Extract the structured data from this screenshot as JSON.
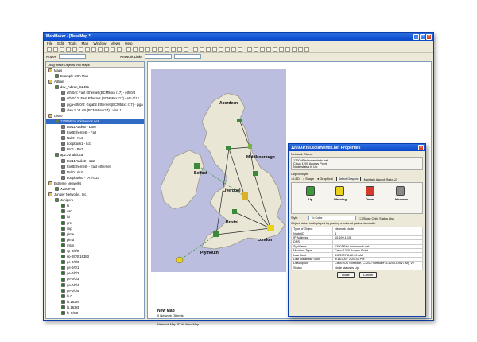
{
  "window": {
    "title": "MapMaker - [New Map *]"
  },
  "menu": [
    "File",
    "Edit",
    "Tools",
    "Map",
    "Window",
    "Views",
    "Help"
  ],
  "toolbar2": {
    "nodes_label": "Nodes",
    "tab_label": "Network Links"
  },
  "left_panel": {
    "header": "Drag these Objects into Maps",
    "items": [
      {
        "text": "Maps",
        "indent": 0,
        "icon": "folder-icon",
        "color": "#e8c04a"
      },
      {
        "text": "Example USA Map",
        "indent": 1,
        "icon": "map-icon",
        "color": "#4a8f3a"
      },
      {
        "text": "Adtran",
        "indent": 0,
        "icon": "folder-icon",
        "color": "#e8c04a"
      },
      {
        "text": "dev_Adtran_C2451",
        "indent": 1,
        "icon": "device-icon",
        "color": "#4a8f3a"
      },
      {
        "text": "eth 0/4: Fast Ethernet (BCM56xx r17) - eth 0/4",
        "indent": 2,
        "icon": "port-icon",
        "color": "#777"
      },
      {
        "text": "eth 0/12: Fast Ethernet (BCM56xx r17) - eth 0/12",
        "indent": 2,
        "icon": "port-icon",
        "color": "#777"
      },
      {
        "text": "giga-eth 0/4: Gigabit Ethernet (BCM56xx r17) - giga",
        "indent": 2,
        "icon": "port-icon",
        "color": "#777"
      },
      {
        "text": "vlan 1: VLAN (BCM56xx r17) - vlan 1",
        "indent": 2,
        "icon": "port-icon",
        "color": "#777"
      },
      {
        "text": "Cisco",
        "indent": 0,
        "icon": "folder-icon",
        "color": "#e8c04a"
      },
      {
        "text": "1200AP.tul.solarwinds.net",
        "indent": 1,
        "icon": "device-icon",
        "color": "#4a8f3a",
        "selected": true
      },
      {
        "text": "Dot11Radio0 - Dot0",
        "indent": 2,
        "icon": "port-icon",
        "color": "#777"
      },
      {
        "text": "FastEthernet0 - Fa0",
        "indent": 2,
        "icon": "port-icon",
        "color": "#777"
      },
      {
        "text": "Null0 - Nu0",
        "indent": 2,
        "icon": "port-icon",
        "color": "#777"
      },
      {
        "text": "Loopback1 - Lo1",
        "indent": 2,
        "icon": "port-icon",
        "color": "#777"
      },
      {
        "text": "BVI1 - BV1",
        "indent": 2,
        "icon": "port-icon",
        "color": "#777"
      },
      {
        "text": "ap2.zvnab.local",
        "indent": 1,
        "icon": "device-icon",
        "color": "#4a8f3a"
      },
      {
        "text": "Dot11Radio0 - 1111",
        "indent": 2,
        "icon": "port-icon",
        "color": "#777"
      },
      {
        "text": "FastEthernet0 - (fast ethernet)",
        "indent": 2,
        "icon": "port-icon",
        "color": "#777"
      },
      {
        "text": "Null0 - Nu0",
        "indent": 2,
        "icon": "port-icon",
        "color": "#777"
      },
      {
        "text": "Loopback0 - TATA123",
        "indent": 2,
        "icon": "port-icon",
        "color": "#777"
      },
      {
        "text": "Extreme Networks",
        "indent": 0,
        "icon": "folder-icon",
        "color": "#e8c04a"
      },
      {
        "text": "X250e-48",
        "indent": 1,
        "icon": "device-icon",
        "color": "#4a8f3a"
      },
      {
        "text": "Juniper Networks, Inc.",
        "indent": 0,
        "icon": "folder-icon",
        "color": "#e8c04a"
      },
      {
        "text": "Juniper1",
        "indent": 1,
        "icon": "device-icon",
        "color": "#4a8f3a"
      },
      {
        "text": "lo",
        "indent": 2,
        "icon": "port-icon",
        "color": "#2a7a2a"
      },
      {
        "text": "dsc",
        "indent": 2,
        "icon": "port-icon",
        "color": "#2a7a2a"
      },
      {
        "text": "lsi",
        "indent": 2,
        "icon": "port-icon",
        "color": "#2a7a2a"
      },
      {
        "text": "gre",
        "indent": 2,
        "icon": "port-icon",
        "color": "#2a7a2a"
      },
      {
        "text": "ipip",
        "indent": 2,
        "icon": "port-icon",
        "color": "#2a7a2a"
      },
      {
        "text": "pime",
        "indent": 2,
        "icon": "port-icon",
        "color": "#2a7a2a"
      },
      {
        "text": "pimd",
        "indent": 2,
        "icon": "port-icon",
        "color": "#2a7a2a"
      },
      {
        "text": "mtun",
        "indent": 2,
        "icon": "port-icon",
        "color": "#2a7a2a"
      },
      {
        "text": "sp-0/0/0",
        "indent": 2,
        "icon": "port-icon",
        "color": "#2a7a2a"
      },
      {
        "text": "sp-0/0/0.16383",
        "indent": 2,
        "icon": "port-icon",
        "color": "#2a7a2a"
      },
      {
        "text": "ge-0/0/0",
        "indent": 2,
        "icon": "port-icon",
        "color": "#2a7a2a"
      },
      {
        "text": "ge-0/0/1",
        "indent": 2,
        "icon": "port-icon",
        "color": "#2a7a2a"
      },
      {
        "text": "ge-0/0/2",
        "indent": 2,
        "icon": "port-icon",
        "color": "#2a7a2a"
      },
      {
        "text": "ge-0/0/3",
        "indent": 2,
        "icon": "port-icon",
        "color": "#2a7a2a"
      },
      {
        "text": "ge-0/0/4",
        "indent": 2,
        "icon": "port-icon",
        "color": "#2a7a2a"
      },
      {
        "text": "ge-0/0/5",
        "indent": 2,
        "icon": "port-icon",
        "color": "#2a7a2a"
      },
      {
        "text": "lo.0",
        "indent": 2,
        "icon": "port-icon",
        "color": "#2a7a2a"
      },
      {
        "text": "lo.16384",
        "indent": 2,
        "icon": "port-icon",
        "color": "#2a7a2a"
      },
      {
        "text": "lo.16385",
        "indent": 2,
        "icon": "port-icon",
        "color": "#2a7a2a"
      },
      {
        "text": "fe-0/0/0",
        "indent": 2,
        "icon": "port-icon",
        "color": "#2a7a2a"
      }
    ]
  },
  "map": {
    "tabs": [
      "Network Links",
      "",
      ""
    ],
    "labels": [
      "Aberdeen",
      "Middlesbrough",
      "Belfast",
      "Liverpool",
      "Bristol",
      "Plymouth",
      "London"
    ],
    "footer_title": "New Map",
    "footer_sub": "0 Network Objects",
    "footer_status": "Network Map ID ## New Map"
  },
  "dialog": {
    "title": "1200AP.tul.solarwinds.net Properties",
    "section_network": "Network Object",
    "obj_line1": "1200AP.tul.solarwinds.net",
    "obj_line2": "Cisco 1200 Access Point",
    "obj_line3": "Node status is Up.",
    "object_style_label": "Object Style",
    "radio_led": "LED",
    "radio_shape": "Shape",
    "radio_graphical": "Graphical",
    "select_graphic": "Select Graphic",
    "maintain_aspect": "Maintain Aspect Ratio",
    "statuses": [
      {
        "label": "Up",
        "color": "#3a9a3a"
      },
      {
        "label": "Warning",
        "color": "#e8d21a"
      },
      {
        "label": "Down",
        "color": "#d83a2a"
      },
      {
        "label": "Unknown",
        "color": "#8a8a8a"
      }
    ],
    "style_label": "Style",
    "style_value": "To Color",
    "show_child": "Show Child Status Also",
    "status_note": "Object status is displayed by placing a colored pad underneath.",
    "props": [
      [
        "Type of Object",
        "Network Node"
      ],
      [
        "Node ID",
        "4"
      ],
      [
        "IP Address",
        "10.199.1.15"
      ],
      [
        "DNS",
        ""
      ],
      [
        "SysName",
        "1200AP.tul.solarwinds.net"
      ],
      [
        "Machine Type",
        "Cisco 1200 Access Point"
      ],
      [
        "Last Boot",
        "8/5/2007 8:22:00 AM"
      ],
      [
        "Last Database Sync",
        "9/13/2007 2:20:32 PM"
      ],
      [
        "Description",
        "Cisco IOS Software, C1200 Software (C1200-K9W7-M), Ve"
      ],
      [
        "Status",
        "Node status is Up."
      ]
    ],
    "done": "Done",
    "cancel": "Cancel"
  }
}
